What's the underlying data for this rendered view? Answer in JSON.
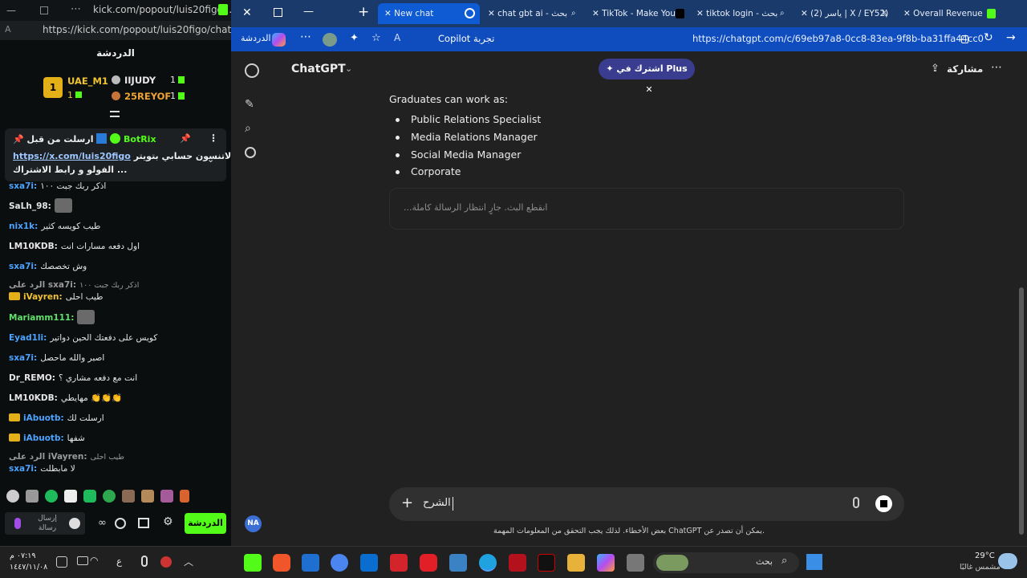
{
  "kick": {
    "window_title": "kick.com/popout/luis20figo...",
    "url": "https://kick.com/popout/luis20figo/chat",
    "chat_header": "الدردشة",
    "leaderboard": {
      "first": {
        "rank": "1",
        "name": "UAE_M1",
        "count": "1"
      },
      "second": {
        "name": "IIJUDY",
        "count": "1"
      },
      "third": {
        "name": "25REYOF",
        "count": "1"
      }
    },
    "pinned": {
      "line1": "ارسلت من قبل",
      "author": "BotRix",
      "line2_prefix": "لاتنسون حسابي بتويتر",
      "link": "https://x.com/luis20figo",
      "line3": "الفولو و رابط الاشتراك ..."
    },
    "messages": [
      {
        "user": "sxa7i:",
        "text": "اذكر ربك جبت ١٠٠"
      },
      {
        "user": "SaLh_98:",
        "text": ""
      },
      {
        "user": "nix1k:",
        "text": "طيب كويسه كثير"
      },
      {
        "user": "LM10KDB:",
        "text": "اول دفعه مسارات انت"
      },
      {
        "user": "sxa7i:",
        "text": "وش تخصصك"
      },
      {
        "user": "الرد على sxa7i:",
        "text": "اذكر ربك جبت ١٠٠"
      },
      {
        "user": "iVayren:",
        "text": "طيب احلى"
      },
      {
        "user": "Mariamm111:",
        "text": ""
      },
      {
        "user": "Eyad1li:",
        "text": "كويس على دفعتك الحين دواتير"
      },
      {
        "user": "sxa7i:",
        "text": "اصبر والله ماحصل"
      },
      {
        "user": "Dr_REMO:",
        "text": "انت مع دفعه مشاري ؟"
      },
      {
        "user": "LM10KDB:",
        "text": "مهايطي 👏👏👏"
      },
      {
        "user": "iAbuotb:",
        "text": "ارسلت لك"
      },
      {
        "user": "iAbuotb:",
        "text": "شفها"
      },
      {
        "user": "الرد على iVayren:",
        "text": "طيب احلى"
      },
      {
        "user": "sxa7i:",
        "text": "لا مابطلت"
      }
    ],
    "send_placeholder": "إرسال رسالة",
    "chat_button": "الدردشة"
  },
  "edge": {
    "tabs": [
      {
        "label": "New chat"
      },
      {
        "label": "chat gbt ai - بحث"
      },
      {
        "label": "TikTok - Make You"
      },
      {
        "label": "tiktok login - بحث"
      },
      {
        "label": "(2) ياسر | X / EY52)"
      },
      {
        "label": "Overall Revenue"
      }
    ],
    "profile_label": "الدردشة",
    "copilot_label": "Copilot تجربة",
    "url": "https://chatgpt.com/c/69eb97a8-0cc8-83ea-9f8b-ba31ffa44cc0",
    "brand": "ChatGPT",
    "plus_pill": "اشترك في Plus",
    "share_label": "مشاركة",
    "intro": "Graduates can work as:",
    "list": [
      "Public Relations Specialist",
      "Media Relations Manager",
      "Social Media Manager",
      "Corporate"
    ],
    "interrupt_text": "...انقطع البث. جارٍ انتظار الرسالة كاملة",
    "composer_text": "الشرح",
    "disclaimer": "بعض الأخطاء. لذلك يجب التحقق من المعلومات المهمة ChatGPT يمكن أن تصدر عن.",
    "avatar": "NA"
  },
  "taskbar": {
    "time": "٠٧:١٩ م",
    "date": "١٤٤٧/١١/٠٨",
    "lang": "ع",
    "search_label": "بحث",
    "temp": "29°C",
    "weather": "مشمس غالبًا"
  },
  "colors": {
    "kick_green": "#53fc18",
    "edge_blue": "#0f4dbf",
    "chat_bg": "#212121"
  }
}
